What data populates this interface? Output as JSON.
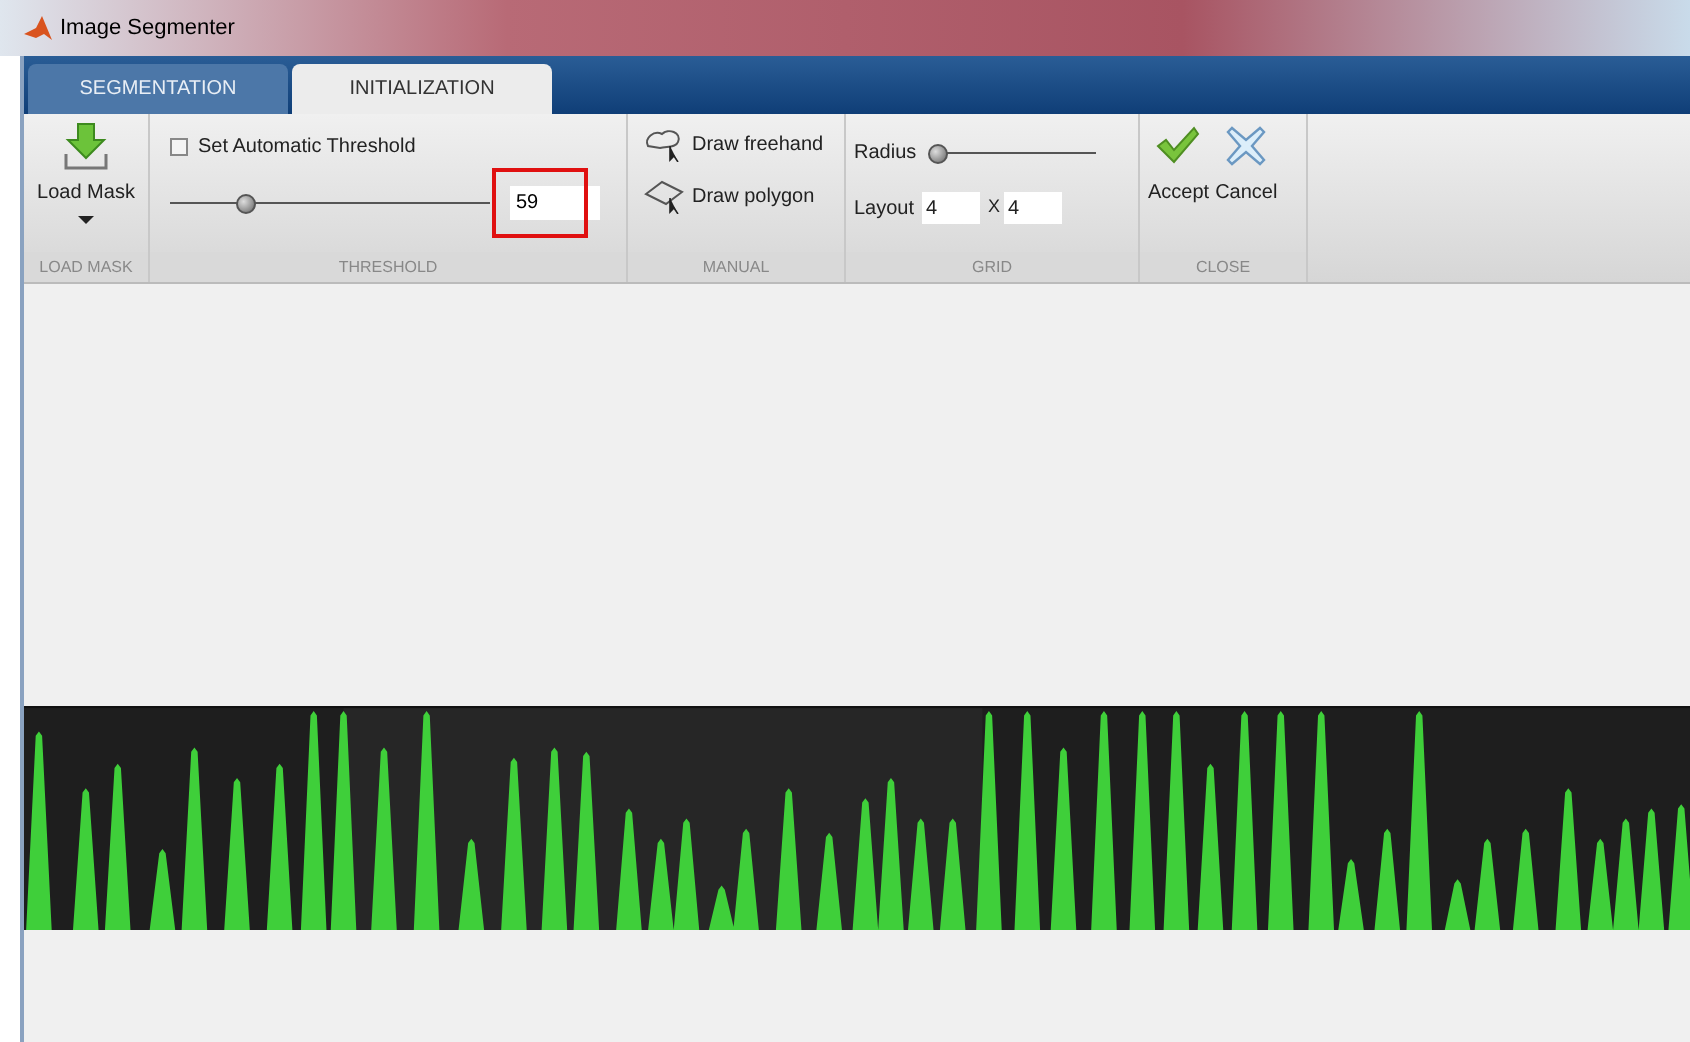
{
  "window": {
    "title": "Image Segmenter"
  },
  "tabs": [
    {
      "label": "SEGMENTATION",
      "selected": false
    },
    {
      "label": "INITIALIZATION",
      "selected": true
    }
  ],
  "ribbon": {
    "load_mask": {
      "button": "Load Mask",
      "section": "LOAD MASK"
    },
    "threshold": {
      "checkbox": {
        "label": "Set Automatic Threshold",
        "checked": false
      },
      "slider": {
        "level": 0.24
      },
      "value": "59",
      "highlighted": true,
      "section": "THRESHOLD"
    },
    "manual": {
      "buttons": [
        "Draw freehand",
        "Draw polygon"
      ],
      "section": "MANUAL"
    },
    "grid": {
      "radius_label": "Radius",
      "radius": {
        "level": 0.04
      },
      "layout_label": "Layout",
      "rows": "4",
      "separator": "X",
      "columns": "4",
      "section": "GRID"
    },
    "close": {
      "accept": "Accept",
      "cancel": "Cancel",
      "section": "CLOSE"
    }
  }
}
